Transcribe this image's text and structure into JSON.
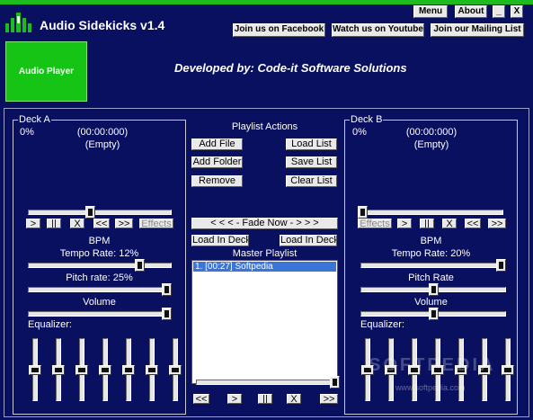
{
  "app": {
    "title": "Audio Sidekicks v1.4"
  },
  "window_controls": {
    "menu": "Menu",
    "about": "About",
    "minimize": "_",
    "close": "X"
  },
  "links": {
    "facebook": "Join us on Facebook",
    "youtube": "Watch us on Youtube",
    "mailing": "Join our Mailing List"
  },
  "nav": {
    "audio_player": "Audio Player"
  },
  "developer": "Developed by: Code-it Software Solutions",
  "colors": {
    "background": "#0a1060",
    "accent_green": "#16c416",
    "selection": "#3b75d8"
  },
  "deck_a": {
    "title": "Deck A",
    "progress": "0%",
    "time": "(00:00:000)",
    "track": "(Empty)",
    "transport": {
      "play": ">",
      "pause": "||",
      "stop": "X",
      "rewind": "<<",
      "forward": ">>",
      "effects": "Effects"
    },
    "bpm_label": "BPM",
    "tempo_label": "Tempo Rate: 12%",
    "pitch_label": "Pitch rate: 25%",
    "volume_label": "Volume",
    "equalizer_label": "Equalizer:",
    "seek_fraction": 0.43,
    "tempo_fraction": 0.8,
    "pitch_fraction": 1.0,
    "volume_fraction": 1.0,
    "eq_levels": [
      0.5,
      0.5,
      0.5,
      0.5,
      0.5,
      0.5,
      0.5
    ]
  },
  "deck_b": {
    "title": "Deck B",
    "progress": "0%",
    "time": "(00:00:000)",
    "track": "(Empty)",
    "transport": {
      "play": ">",
      "pause": "||",
      "stop": "X",
      "rewind": "<<",
      "forward": ">>",
      "effects": "Effects"
    },
    "bpm_label": "BPM",
    "tempo_label": "Tempo Rate: 20%",
    "pitch_label": "Pitch Rate",
    "volume_label": "Volume",
    "equalizer_label": "Equalizer:",
    "seek_fraction": 0.0,
    "tempo_fraction": 1.0,
    "pitch_fraction": 0.5,
    "volume_fraction": 0.5,
    "eq_levels": [
      0.5,
      0.5,
      0.5,
      0.5,
      0.5,
      0.5,
      0.5
    ]
  },
  "playlist_actions": {
    "title": "Playlist Actions",
    "add_file": "Add File",
    "load_list": "Load List",
    "add_folder": "Add Folder",
    "save_list": "Save List",
    "remove": "Remove",
    "clear_list": "Clear List",
    "fade_now": "< < < - Fade Now - > > >",
    "load_deck_a": "Load In Deck A",
    "load_deck_b": "Load In Deck B"
  },
  "master_playlist": {
    "title": "Master Playlist",
    "items": [
      "1. [00:27] Softpedia"
    ],
    "position_fraction": 1.0,
    "transport": {
      "rewind": "<<",
      "play": ">",
      "pause": "||",
      "stop": "X",
      "forward": ">>"
    }
  },
  "watermark": {
    "main": "SOFTPEDIA",
    "sub": "www.softpedia.com"
  }
}
